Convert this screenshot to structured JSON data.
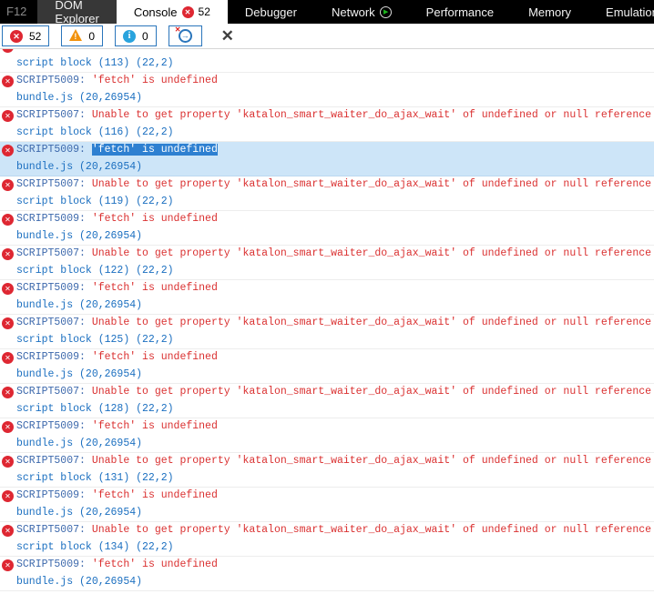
{
  "colors": {
    "accent_border": "#2a75bb",
    "error_red": "#da3030",
    "code_blue": "#3d69ac",
    "link_blue": "#1b6fc0",
    "selected_row_bg": "#cde5f8",
    "text_selection_bg": "#2e80d1",
    "badge_red": "#de2732",
    "warning_orange": "#f2920c",
    "info_blue": "#29a3dd",
    "play_green": "#1db31d"
  },
  "tabbar": {
    "f12_label": "F12",
    "tabs": [
      {
        "id": "dom-explorer",
        "label": "DOM Explorer"
      },
      {
        "id": "console",
        "label": "Console",
        "badge": "52",
        "badge_icon": "error-circle-x-icon"
      },
      {
        "id": "debugger",
        "label": "Debugger"
      },
      {
        "id": "network",
        "label": "Network",
        "icon": "play-circle-icon"
      },
      {
        "id": "performance",
        "label": "Performance"
      },
      {
        "id": "memory",
        "label": "Memory"
      },
      {
        "id": "emulation",
        "label": "Emulation"
      }
    ]
  },
  "toolbar": {
    "error_count": "52",
    "warning_count": "0",
    "info_count": "0",
    "icons": [
      "error-filter-icon",
      "warning-filter-icon",
      "info-filter-icon",
      "clear-on-navigate-icon",
      "clear-console-icon"
    ]
  },
  "console": {
    "entries": [
      {
        "partial": true,
        "source": "script block (113) (22,2)"
      },
      {
        "code": "SCRIPT5009:",
        "message": "'fetch' is undefined",
        "source": "bundle.js (20,26954)"
      },
      {
        "code": "SCRIPT5007:",
        "message": "Unable to get property 'katalon_smart_waiter_do_ajax_wait' of undefined or null reference",
        "source": "script block (116) (22,2)"
      },
      {
        "code": "SCRIPT5009:",
        "message": "'fetch' is undefined",
        "source": "bundle.js (20,26954)",
        "selected": true,
        "selection_text": "'fetch' is undefined"
      },
      {
        "code": "SCRIPT5007:",
        "message": "Unable to get property 'katalon_smart_waiter_do_ajax_wait' of undefined or null reference",
        "source": "script block (119) (22,2)"
      },
      {
        "code": "SCRIPT5009:",
        "message": "'fetch' is undefined",
        "source": "bundle.js (20,26954)"
      },
      {
        "code": "SCRIPT5007:",
        "message": "Unable to get property 'katalon_smart_waiter_do_ajax_wait' of undefined or null reference",
        "source": "script block (122) (22,2)"
      },
      {
        "code": "SCRIPT5009:",
        "message": "'fetch' is undefined",
        "source": "bundle.js (20,26954)"
      },
      {
        "code": "SCRIPT5007:",
        "message": "Unable to get property 'katalon_smart_waiter_do_ajax_wait' of undefined or null reference",
        "source": "script block (125) (22,2)"
      },
      {
        "code": "SCRIPT5009:",
        "message": "'fetch' is undefined",
        "source": "bundle.js (20,26954)"
      },
      {
        "code": "SCRIPT5007:",
        "message": "Unable to get property 'katalon_smart_waiter_do_ajax_wait' of undefined or null reference",
        "source": "script block (128) (22,2)"
      },
      {
        "code": "SCRIPT5009:",
        "message": "'fetch' is undefined",
        "source": "bundle.js (20,26954)"
      },
      {
        "code": "SCRIPT5007:",
        "message": "Unable to get property 'katalon_smart_waiter_do_ajax_wait' of undefined or null reference",
        "source": "script block (131) (22,2)"
      },
      {
        "code": "SCRIPT5009:",
        "message": "'fetch' is undefined",
        "source": "bundle.js (20,26954)"
      },
      {
        "code": "SCRIPT5007:",
        "message": "Unable to get property 'katalon_smart_waiter_do_ajax_wait' of undefined or null reference",
        "source": "script block (134) (22,2)"
      },
      {
        "code": "SCRIPT5009:",
        "message": "'fetch' is undefined",
        "source": "bundle.js (20,26954)"
      }
    ]
  }
}
